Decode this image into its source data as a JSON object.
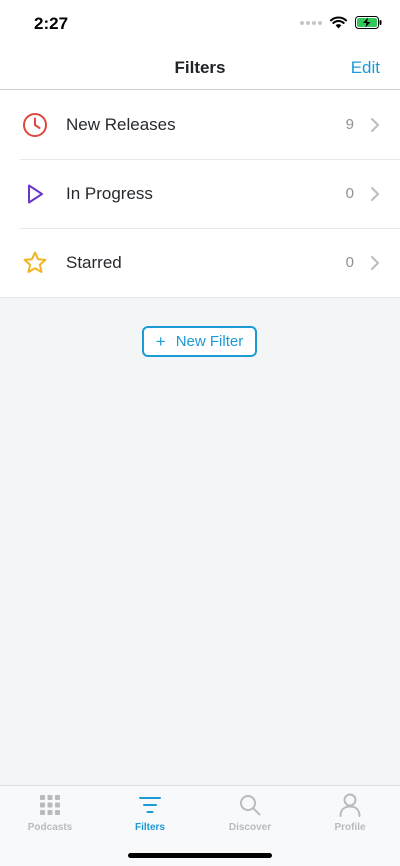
{
  "status_bar": {
    "time": "2:27"
  },
  "nav": {
    "title": "Filters",
    "edit_label": "Edit"
  },
  "filters": [
    {
      "label": "New Releases",
      "count": "9",
      "icon": "clock-icon",
      "color": "#e0473e"
    },
    {
      "label": "In Progress",
      "count": "0",
      "icon": "play-icon",
      "color": "#6a35c9"
    },
    {
      "label": "Starred",
      "count": "0",
      "icon": "star-icon",
      "color": "#f2b521"
    }
  ],
  "new_filter_button": {
    "label": "New Filter"
  },
  "tab_bar": {
    "tabs": [
      {
        "label": "Podcasts",
        "icon": "grid-icon",
        "active": false
      },
      {
        "label": "Filters",
        "icon": "filter-lines-icon",
        "active": true
      },
      {
        "label": "Discover",
        "icon": "search-icon",
        "active": false
      },
      {
        "label": "Profile",
        "icon": "person-icon",
        "active": false
      }
    ]
  },
  "colors": {
    "accent": "#1b9ad6",
    "inactive_tab": "#b7bbc0",
    "background": "#f4f5f7"
  }
}
